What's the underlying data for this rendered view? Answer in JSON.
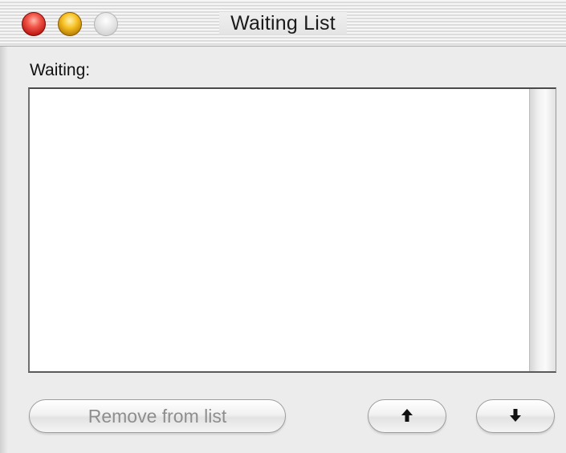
{
  "window": {
    "title": "Waiting List",
    "controls": {
      "close_color": "#e6473b",
      "minimize_color": "#f4b61f",
      "zoom_color": "#d9d9d9"
    }
  },
  "main": {
    "list_label": "Waiting:",
    "list_items": [],
    "buttons": {
      "remove_label": "Remove from list",
      "remove_enabled": false,
      "move_up_icon": "arrow-up-icon",
      "move_down_icon": "arrow-down-icon"
    }
  }
}
